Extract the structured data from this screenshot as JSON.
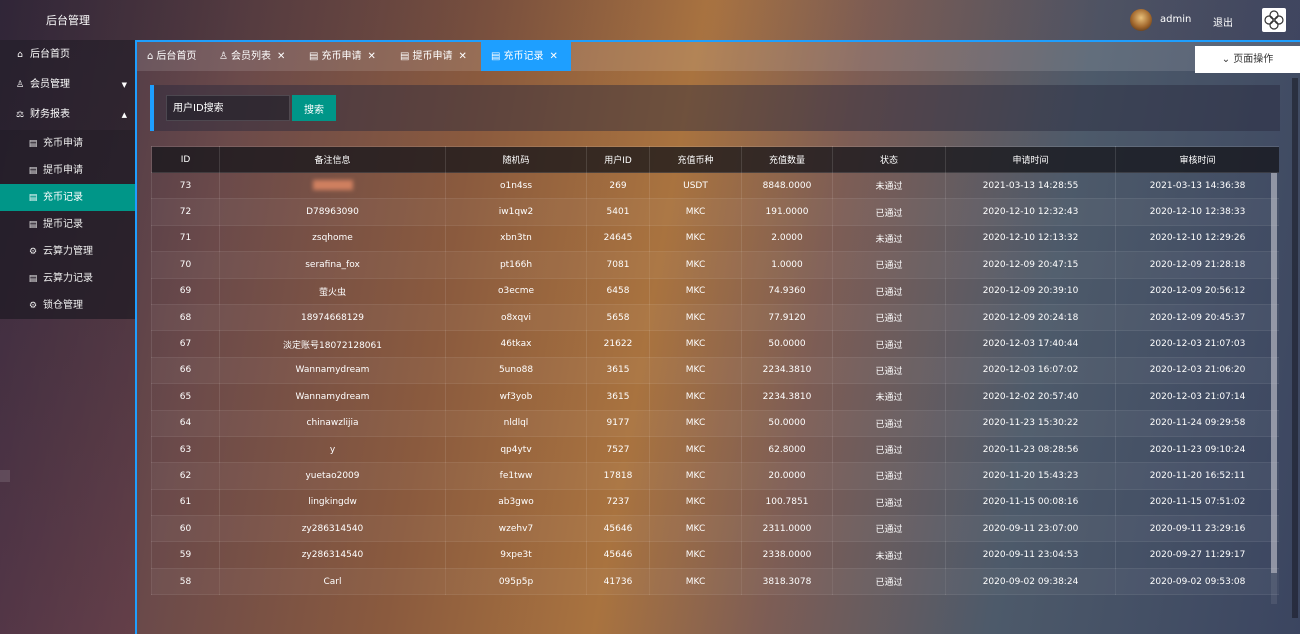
{
  "header": {
    "title": "后台管理",
    "user": "admin",
    "logout": "退出"
  },
  "sidebar": {
    "items": [
      {
        "label": "后台首页",
        "icon": "home-icon"
      },
      {
        "label": "会员管理",
        "icon": "user-icon"
      },
      {
        "label": "财务报表",
        "icon": "finance-icon"
      }
    ],
    "subitems": [
      {
        "label": "充币申请",
        "icon": "document-icon"
      },
      {
        "label": "提币申请",
        "icon": "document-icon"
      },
      {
        "label": "充币记录",
        "icon": "document-icon"
      },
      {
        "label": "提币记录",
        "icon": "document-icon"
      },
      {
        "label": "云算力管理",
        "icon": "gear-icon"
      },
      {
        "label": "云算力记录",
        "icon": "document-icon"
      },
      {
        "label": "锁仓管理",
        "icon": "gear-icon"
      }
    ]
  },
  "tabs": [
    {
      "label": "后台首页",
      "icon": "home-icon"
    },
    {
      "label": "会员列表",
      "icon": "user-icon"
    },
    {
      "label": "充币申请",
      "icon": "document-icon"
    },
    {
      "label": "提币申请",
      "icon": "document-icon"
    },
    {
      "label": "充币记录",
      "icon": "document-icon"
    }
  ],
  "page_ops": "页面操作",
  "search": {
    "placeholder": "用户ID搜索",
    "button": "搜索"
  },
  "table": {
    "headers": [
      "ID",
      "备注信息",
      "随机码",
      "用户ID",
      "充值币种",
      "充值数量",
      "状态",
      "申请时间",
      "审核时间"
    ],
    "rows": [
      [
        "73",
        "",
        "o1n4ss",
        "269",
        "USDT",
        "8848.0000",
        "未通过",
        "2021-03-13 14:28:55",
        "2021-03-13 14:36:38"
      ],
      [
        "72",
        "D78963090",
        "iw1qw2",
        "5401",
        "MKC",
        "191.0000",
        "已通过",
        "2020-12-10 12:32:43",
        "2020-12-10 12:38:33"
      ],
      [
        "71",
        "zsqhome",
        "xbn3tn",
        "24645",
        "MKC",
        "2.0000",
        "未通过",
        "2020-12-10 12:13:32",
        "2020-12-10 12:29:26"
      ],
      [
        "70",
        "serafina_fox",
        "pt166h",
        "7081",
        "MKC",
        "1.0000",
        "已通过",
        "2020-12-09 20:47:15",
        "2020-12-09 21:28:18"
      ],
      [
        "69",
        "萤火虫",
        "o3ecme",
        "6458",
        "MKC",
        "74.9360",
        "已通过",
        "2020-12-09 20:39:10",
        "2020-12-09 20:56:12"
      ],
      [
        "68",
        "18974668129",
        "o8xqvi",
        "5658",
        "MKC",
        "77.9120",
        "已通过",
        "2020-12-09 20:24:18",
        "2020-12-09 20:45:37"
      ],
      [
        "67",
        "淡定账号18072128061",
        "46tkax",
        "21622",
        "MKC",
        "50.0000",
        "已通过",
        "2020-12-03 17:40:44",
        "2020-12-03 21:07:03"
      ],
      [
        "66",
        "Wannamydream",
        "5uno88",
        "3615",
        "MKC",
        "2234.3810",
        "已通过",
        "2020-12-03 16:07:02",
        "2020-12-03 21:06:20"
      ],
      [
        "65",
        "Wannamydream",
        "wf3yob",
        "3615",
        "MKC",
        "2234.3810",
        "未通过",
        "2020-12-02 20:57:40",
        "2020-12-03 21:07:14"
      ],
      [
        "64",
        "chinawzlijia",
        "nldlql",
        "9177",
        "MKC",
        "50.0000",
        "已通过",
        "2020-11-23 15:30:22",
        "2020-11-24 09:29:58"
      ],
      [
        "63",
        "y",
        "qp4ytv",
        "7527",
        "MKC",
        "62.8000",
        "已通过",
        "2020-11-23 08:28:56",
        "2020-11-23 09:10:24"
      ],
      [
        "62",
        "yuetao2009",
        "fe1tww",
        "17818",
        "MKC",
        "20.0000",
        "已通过",
        "2020-11-20 15:43:23",
        "2020-11-20 16:52:11"
      ],
      [
        "61",
        "lingkingdw",
        "ab3gwo",
        "7237",
        "MKC",
        "100.7851",
        "已通过",
        "2020-11-15 00:08:16",
        "2020-11-15 07:51:02"
      ],
      [
        "60",
        "zy286314540",
        "wzehv7",
        "45646",
        "MKC",
        "2311.0000",
        "已通过",
        "2020-09-11 23:07:00",
        "2020-09-11 23:29:16"
      ],
      [
        "59",
        "zy286314540",
        "9xpe3t",
        "45646",
        "MKC",
        "2338.0000",
        "未通过",
        "2020-09-11 23:04:53",
        "2020-09-27 11:29:17"
      ],
      [
        "58",
        "Carl",
        "095p5p",
        "41736",
        "MKC",
        "3818.3078",
        "已通过",
        "2020-09-02 09:38:24",
        "2020-09-02 09:53:08"
      ]
    ]
  }
}
